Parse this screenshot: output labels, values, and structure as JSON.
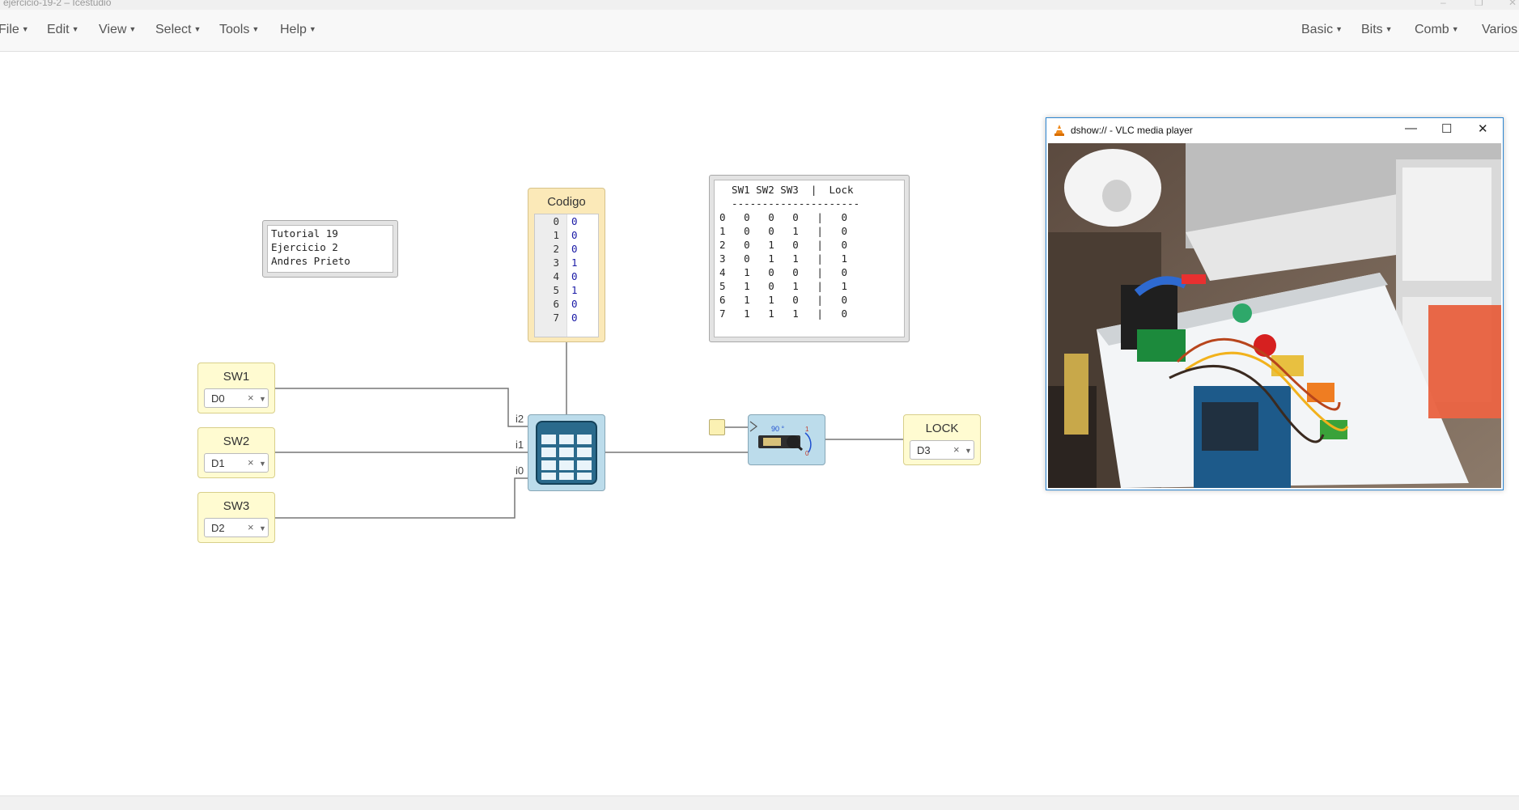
{
  "window": {
    "title": "ejercicio-19-2 – Icestudio",
    "controls": [
      "–",
      "❐",
      "✕"
    ]
  },
  "menu": {
    "left": [
      "File",
      "Edit",
      "View",
      "Select",
      "Tools",
      "Help"
    ],
    "right": [
      "Basic",
      "Bits",
      "Comb",
      "Varios"
    ]
  },
  "note": {
    "lines": [
      "Tutorial 19",
      "Ejercicio 2",
      "Andres Prieto"
    ]
  },
  "codigo": {
    "label": "Codigo",
    "rows": [
      {
        "addr": "0",
        "value": "0"
      },
      {
        "addr": "1",
        "value": "0"
      },
      {
        "addr": "2",
        "value": "0"
      },
      {
        "addr": "3",
        "value": "1"
      },
      {
        "addr": "4",
        "value": "0"
      },
      {
        "addr": "5",
        "value": "1"
      },
      {
        "addr": "6",
        "value": "0"
      },
      {
        "addr": "7",
        "value": "0"
      }
    ]
  },
  "truth_table": {
    "text": "  SW1 SW2 SW3  |  Lock\n  ---------------------\n0   0   0   0   |   0\n1   0   0   1   |   0\n2   0   1   0   |   0\n3   0   1   1   |   1\n4   1   0   0   |   0\n5   1   0   1   |   1\n6   1   1   0   |   0\n7   1   1   1   |   0"
  },
  "inputs": [
    {
      "name": "SW1",
      "pin": "D0"
    },
    {
      "name": "SW2",
      "pin": "D1"
    },
    {
      "name": "SW3",
      "pin": "D2"
    }
  ],
  "output": {
    "name": "LOCK",
    "pin": "D3"
  },
  "select_clear": "×",
  "rom_ports": [
    "i2",
    "i1",
    "i0"
  ],
  "servo": {
    "angle_label": "90 °",
    "max_label": "1",
    "min_label": "0"
  },
  "vlc": {
    "title": "dshow:// - VLC media player",
    "controls": [
      "—",
      "☐",
      "✕"
    ]
  }
}
